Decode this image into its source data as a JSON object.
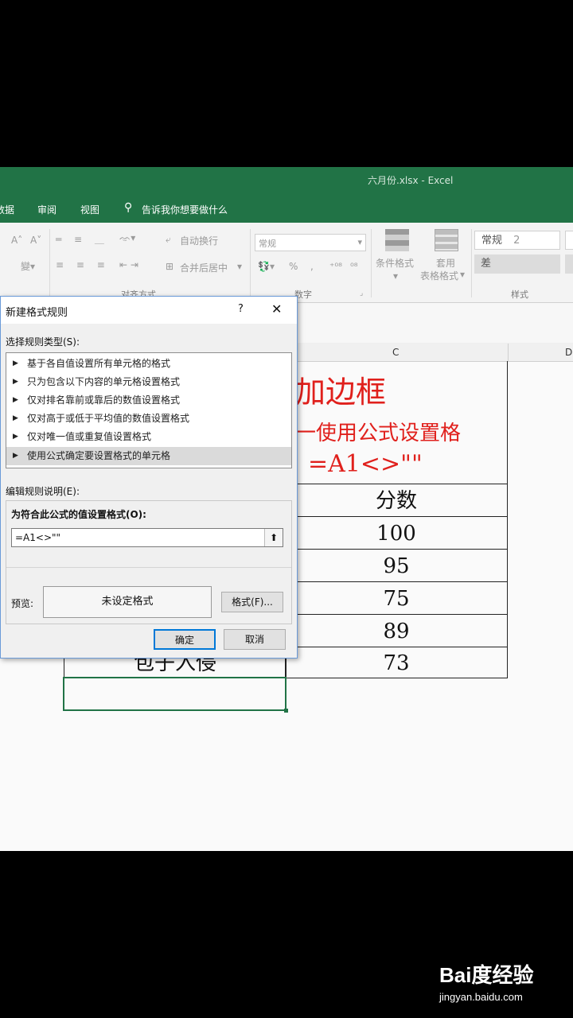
{
  "window": {
    "title": "六月份.xlsx  -  Excel"
  },
  "tabs": [
    "数据",
    "审阅",
    "视图"
  ],
  "tell_me": "告诉我你想要做什么",
  "ribbon": {
    "wrap_text": "自动换行",
    "merge_center": "合并后居中",
    "number_format": "常规",
    "percent": "%",
    "comma": ",",
    "conditional_format": "条件格式",
    "table_format_line1": "套用",
    "table_format_line2": "表格格式",
    "style_normal": "常规",
    "style_number": "2",
    "style_bad": "差",
    "group_alignment": "对齐方式",
    "group_number": "数字",
    "group_styles": "样式"
  },
  "sheet": {
    "col_c": "C",
    "col_d": "D",
    "title_line1": "加边框",
    "title_line2": "一使用公式设置格",
    "title_line3": "=A1<>\"\"",
    "header_score": "分数",
    "scores": [
      "100",
      "95",
      "75",
      "89",
      "73"
    ],
    "partial_name": "包子入侵"
  },
  "dialog": {
    "title": "新建格式规则",
    "help": "?",
    "close": "✕",
    "select_rule_type": "选择规则类型(S):",
    "rules": [
      "基于各自值设置所有单元格的格式",
      "只为包含以下内容的单元格设置格式",
      "仅对排名靠前或靠后的数值设置格式",
      "仅对高于或低于平均值的数值设置格式",
      "仅对唯一值或重复值设置格式",
      "使用公式确定要设置格式的单元格"
    ],
    "selected_rule_index": 5,
    "edit_rule_desc": "编辑规则说明(E):",
    "formula_label": "为符合此公式的值设置格式(O):",
    "formula_value": "=A1<>\"\"",
    "preview_label": "预览:",
    "preview_text": "未设定格式",
    "format_button": "格式(F)...",
    "ok_button": "确定",
    "cancel_button": "取消"
  },
  "watermark": {
    "brand": "Bai度经验",
    "url": "jingyan.baidu.com"
  },
  "colors": {
    "excel_green": "#217346",
    "red_text": "#e0201c",
    "selection_blue": "#0078d7"
  }
}
